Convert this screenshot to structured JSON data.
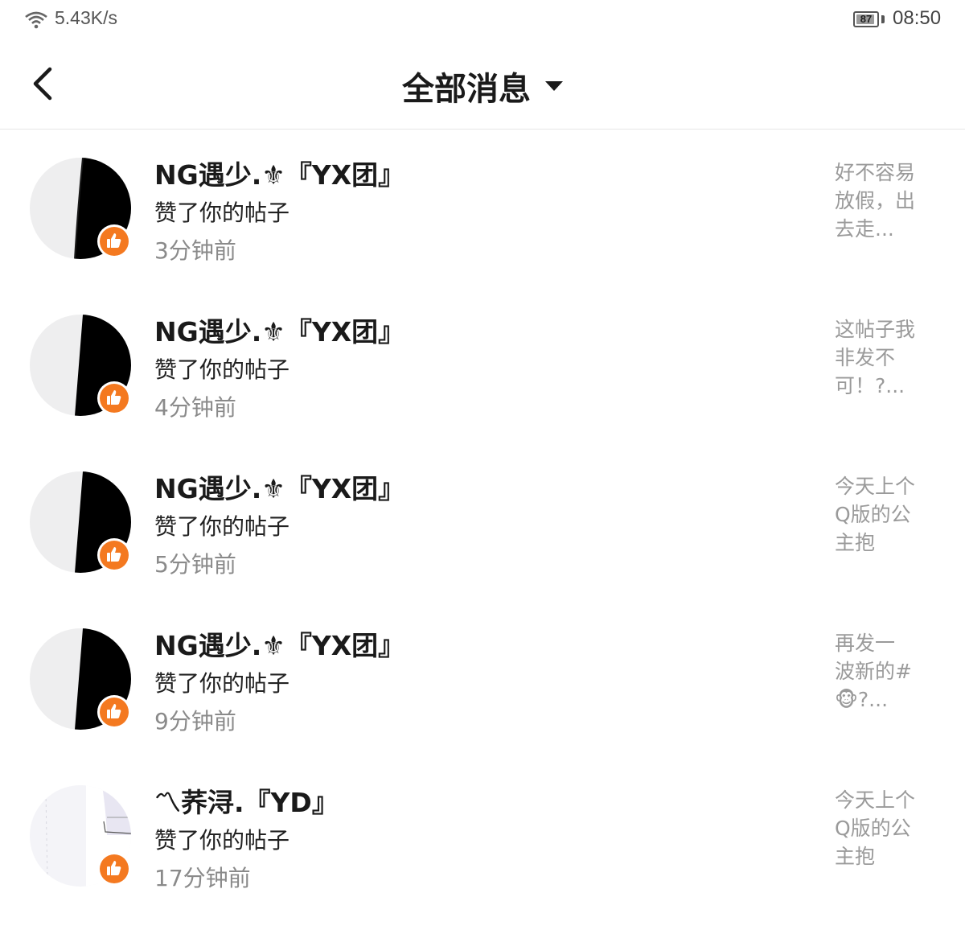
{
  "status_bar": {
    "network_speed": "5.43K/s",
    "battery_level": "87",
    "time": "08:50",
    "wifi_icon": "wifi-icon"
  },
  "header": {
    "title": "全部消息",
    "back_icon": "chevron-left-icon",
    "dropdown_icon": "caret-down-icon"
  },
  "colors": {
    "badge": "#f47920",
    "time_text": "#8a8a8a",
    "preview_text": "#9a9a9a"
  },
  "messages": [
    {
      "user": "NG遇少.⚜『YX团』",
      "action": "赞了你的帖子",
      "time": "3分钟前",
      "preview": "好不容易\n放假，出\n去走...",
      "badge_icon": "thumbs-up-icon"
    },
    {
      "user": "NG遇少.⚜『YX团』",
      "action": "赞了你的帖子",
      "time": "4分钟前",
      "preview": "这帖子我\n非发不\n可！?...",
      "badge_icon": "thumbs-up-icon"
    },
    {
      "user": "NG遇少.⚜『YX团』",
      "action": "赞了你的帖子",
      "time": "5分钟前",
      "preview": "今天上个\nQ版的公\n主抱",
      "badge_icon": "thumbs-up-icon"
    },
    {
      "user": "NG遇少.⚜『YX团』",
      "action": "赞了你的帖子",
      "time": "9分钟前",
      "preview": "再发一\n波新的#\n🐵?...",
      "badge_icon": "thumbs-up-icon"
    },
    {
      "user": "〽荞浔.『YD』",
      "action": "赞了你的帖子",
      "time": "17分钟前",
      "preview": "今天上个\nQ版的公\n主抱",
      "badge_icon": "thumbs-up-icon"
    }
  ]
}
